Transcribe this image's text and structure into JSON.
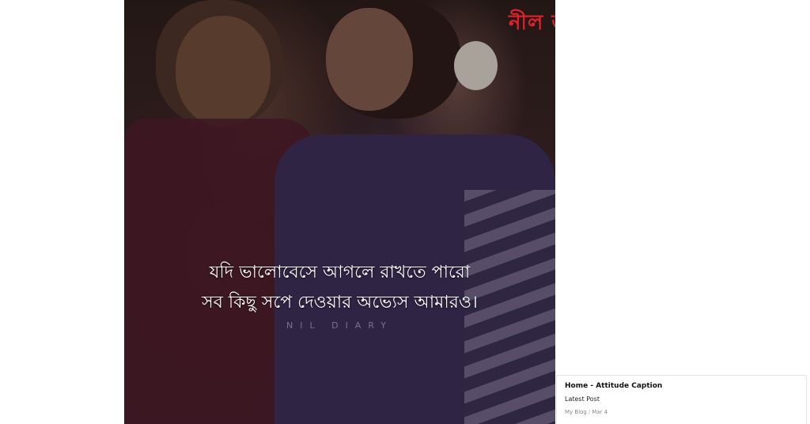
{
  "image": {
    "overlay_text": {
      "line1": "যদি ভালোবেসে আগলে রাখতে পারো",
      "line2": "সব কিছু সপে দেওয়ার অভ্যেস আমারও।",
      "watermark": "NIL DIARY",
      "logo": "নীল ডা"
    }
  },
  "card": {
    "title": "Home - Attitude Caption",
    "subtitle": "Latest Post",
    "meta": {
      "blog": "My Blog",
      "separator": "/",
      "date": "Mar 4"
    }
  },
  "colors": {
    "logo": "#e0202a",
    "caption": "#ffffff",
    "background": "#ffffff"
  }
}
